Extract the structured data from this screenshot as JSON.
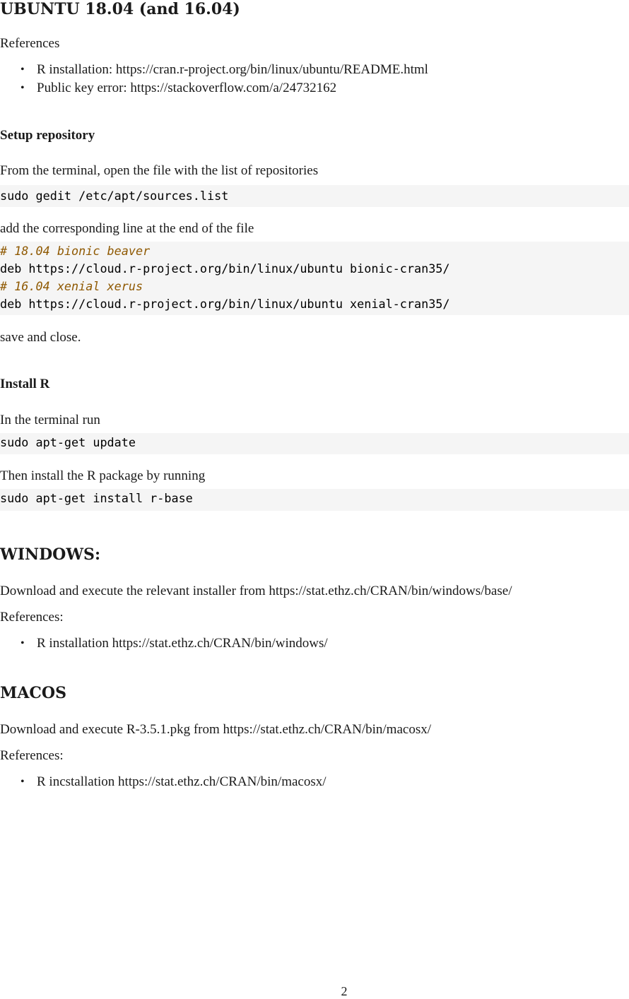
{
  "ubuntu": {
    "title": "UBUNTU 18.04 (and 16.04)",
    "references_label": "References",
    "references": [
      "R installation: https://cran.r-project.org/bin/linux/ubuntu/README.html",
      "Public key error: https://stackoverflow.com/a/24732162"
    ],
    "setup": {
      "title": "Setup repository",
      "intro": "From the terminal, open the file with the list of repositories",
      "cmd_open": "sudo gedit /etc/apt/sources.list",
      "add_line": "add the corresponding line at the end of the file",
      "lines": [
        {
          "text": "# 18.04 bionic beaver",
          "comment": true
        },
        {
          "text": "deb https://cloud.r-project.org/bin/linux/ubuntu bionic-cran35/",
          "comment": false
        },
        {
          "text": "# 16.04 xenial xerus",
          "comment": true
        },
        {
          "text": "deb https://cloud.r-project.org/bin/linux/ubuntu xenial-cran35/",
          "comment": false
        }
      ],
      "save": "save and close."
    },
    "install": {
      "title": "Install R",
      "intro": "In the terminal run",
      "cmd_update": "sudo apt-get update",
      "then": "Then install the R package by running",
      "cmd_install": "sudo apt-get install r-base"
    }
  },
  "windows": {
    "title": "WINDOWS:",
    "download": "Download and execute the relevant installer from https://stat.ethz.ch/CRAN/bin/windows/base/",
    "references_label": "References:",
    "references": [
      "R installation https://stat.ethz.ch/CRAN/bin/windows/"
    ]
  },
  "macos": {
    "title": "MACOS",
    "download": "Download and execute R-3.5.1.pkg from https://stat.ethz.ch/CRAN/bin/macosx/",
    "references_label": "References:",
    "references": [
      "R incstallation https://stat.ethz.ch/CRAN/bin/macosx/"
    ]
  },
  "page_number": "2",
  "colors": {
    "code_background": "#f5f5f5",
    "comment": "#8f5902"
  }
}
